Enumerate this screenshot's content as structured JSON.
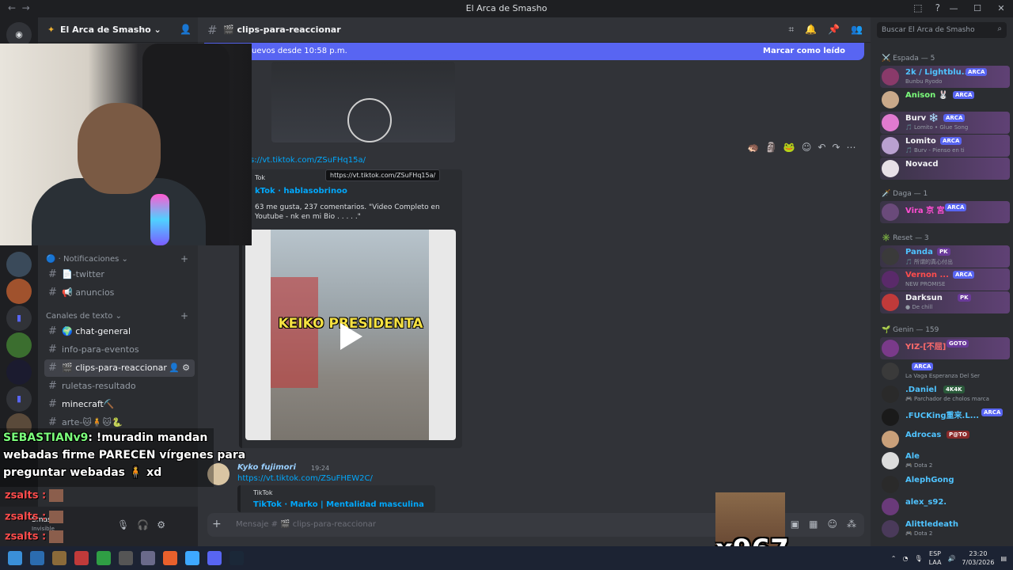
{
  "window": {
    "title": "El Arca de Smasho",
    "controls": [
      "—",
      "☐",
      "✕"
    ]
  },
  "server": {
    "name": "El Arca de Smasho ⌄"
  },
  "sidebar": {
    "categories": [
      {
        "label": "🔵 · Notificaciones ⌄"
      },
      {
        "label": "Canales de texto ⌄"
      }
    ],
    "channels": [
      {
        "label": "📄-twitter"
      },
      {
        "label": "📢 anuncios"
      },
      {
        "label": "🌍 chat-general"
      },
      {
        "label": "info-para-eventos"
      },
      {
        "label": "🎬 clips-para-reaccionar"
      },
      {
        "label": "ruletas-resultado"
      },
      {
        "label": "minecraft⛏️"
      },
      {
        "label": "arte-🐱🧍🐱🐍"
      }
    ]
  },
  "chat": {
    "channel_name": "🎬 clips-para-reaccionar",
    "new_messages": "uevos desde 10:58 p.m.",
    "mark_read": "Marcar como leído",
    "link1": "s://vt.tiktok.com/ZSuFHq15a/",
    "tooltip": "https://vt.tiktok.com/ZSuFHq15a/",
    "embed1": {
      "provider": "Tok",
      "title": "kTok · hablasobrinoo",
      "description": "63 me gusta, 237 comentarios. \"Video Completo en Youtube - nk en mi Bio . . . . .\"",
      "video_caption": "KEIKO PRESIDENTA"
    },
    "msg2": {
      "author": "Kyko fujimori",
      "time": "19:24",
      "link": "https://vt.tiktok.com/ZSuFHEW2C/",
      "embed_provider": "TikTok",
      "embed_title": "TikTok · Marko | Mentalidad masculina"
    },
    "composer_placeholder": "Mensaje # 🎬 clips-para-reaccionar"
  },
  "members": {
    "search_placeholder": "Buscar El Arca de Smasho",
    "roles": [
      {
        "label": "⚔️ Espada — 5"
      },
      {
        "label": "🗡️ Daga — 1"
      },
      {
        "label": "✳️ Reset — 3"
      },
      {
        "label": "🌱 Genin — 159"
      }
    ],
    "list": [
      {
        "name": "2k / Lightblu...",
        "tag": "ARCA",
        "status": "Bunbu Ryodo",
        "color": "#4fc3ff"
      },
      {
        "name": "Anison 🐰",
        "tag": "ARCA",
        "status": "",
        "color": "#7cff7c"
      },
      {
        "name": "Burv ❄️",
        "tag": "ARCA",
        "status": "🎵 Lomito • Glue Song",
        "color": "#f2f3f5"
      },
      {
        "name": "Lomito",
        "tag": "ARCA",
        "status": "🎵 Burv - Pienso en ti",
        "color": "#f2f3f5"
      },
      {
        "name": "Novacd",
        "tag": "",
        "status": "",
        "color": "#f2f3f5"
      },
      {
        "name": "Vira 京 宮",
        "tag": "ARCA",
        "status": "",
        "color": "#ff4dd2"
      },
      {
        "name": "Panda",
        "tag": "PK",
        "status": "🎵 所谓的真心付出",
        "color": "#4fc3ff"
      },
      {
        "name": "Vernon ...",
        "tag": "ARCA",
        "status": "NEW PROMISE",
        "color": "#ff4d4d"
      },
      {
        "name": "Darksun",
        "tag": "PK",
        "status": "● De chill",
        "color": "#f2f3f5"
      },
      {
        "name": "YIZ-[不屈]",
        "tag": "GOTO",
        "status": "",
        "color": "#ff6b6b"
      },
      {
        "name": "",
        "tag": "ARCA",
        "status": "La Vaga Esperanza Del Ser",
        "color": "#f2f3f5"
      },
      {
        "name": ".Daniel",
        "tag": "4K4K",
        "status": "🎮 Parchador de cholos marca",
        "color": "#4fc3ff"
      },
      {
        "name": ".FUCKing重来.L...",
        "tag": "ARCA",
        "status": "",
        "color": "#4fc3ff"
      },
      {
        "name": "Adrocas",
        "tag": "P@TO",
        "status": "",
        "color": "#4fc3ff"
      },
      {
        "name": "Ale",
        "tag": "",
        "status": "🎮 Dota 2",
        "color": "#4fc3ff"
      },
      {
        "name": "AlephGong",
        "tag": "",
        "status": "",
        "color": "#4fc3ff"
      },
      {
        "name": "alex_s92.",
        "tag": "",
        "status": "",
        "color": "#4fc3ff"
      },
      {
        "name": "Alittledeath",
        "tag": "",
        "status": "🎮 Dota 2",
        "color": "#4fc3ff"
      }
    ]
  },
  "overlay": {
    "user": "SEBASTIANv9",
    "line1_rest": ": !muradin mandan",
    "line2": "webadas firme PARECEN vírgenes para",
    "line3": "preguntar webadas 🧍 xd",
    "zsalts": [
      "zsalts :",
      "zsalts :",
      "zsalts :"
    ],
    "big_count": "x967"
  },
  "userpanel": {
    "name": "Smas...",
    "sub": "Invisible"
  },
  "taskbar": {
    "lang1": "ESP",
    "lang2": "LAA",
    "time": "23:20",
    "date": "7/03/2026"
  }
}
